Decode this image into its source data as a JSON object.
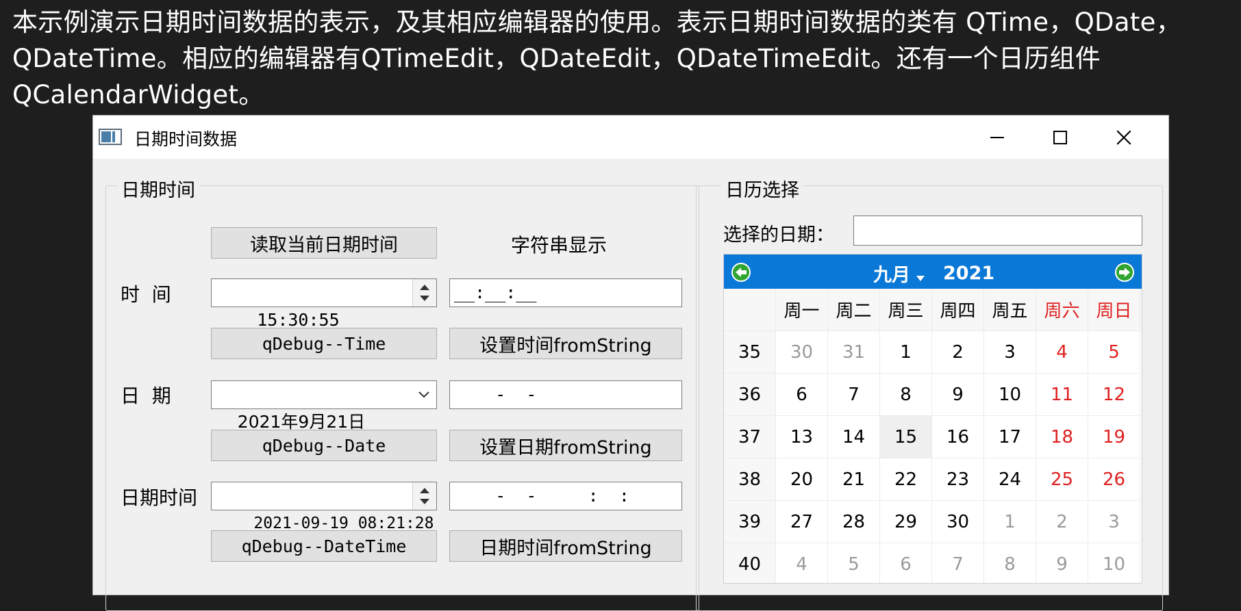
{
  "caption": "本示例演示日期时间数据的表示，及其相应编辑器的使用。表示日期时间数据的类有 QTime，QDate， QDateTime。相应的编辑器有QTimeEdit，QDateEdit，QDateTimeEdit。还有一个日历组件QCalendarWidget。",
  "window": {
    "title": "日期时间数据"
  },
  "left_group": {
    "title": "日期时间",
    "read_button": "读取当前日期时间",
    "string_display_label": "字符串显示",
    "time_label": "时  间",
    "time_value": "15:30:55",
    "time_string": "__:__:__",
    "debug_time_button": "qDebug--Time",
    "set_time_button": "设置时间fromString",
    "date_label": "日  期",
    "date_value": "2021年9月21日",
    "date_string": "    -  -",
    "debug_date_button": "qDebug--Date",
    "set_date_button": "设置日期fromString",
    "datetime_label": "日期时间",
    "datetime_value": "2021-09-19 08:21:28",
    "datetime_string": "    -  -     :  :",
    "debug_datetime_button": "qDebug--DateTime",
    "set_datetime_button": "日期时间fromString"
  },
  "right_group": {
    "title": "日历选择",
    "selected_date_label": "选择的日期：",
    "selected_date_value": ""
  },
  "calendar": {
    "month": "九月",
    "year": "2021",
    "weekdays": [
      "周一",
      "周二",
      "周三",
      "周四",
      "周五",
      "周六",
      "周日"
    ],
    "weeks": [
      {
        "num": "35",
        "days": [
          "30",
          "31",
          "1",
          "2",
          "3",
          "4",
          "5"
        ]
      },
      {
        "num": "36",
        "days": [
          "6",
          "7",
          "8",
          "9",
          "10",
          "11",
          "12"
        ]
      },
      {
        "num": "37",
        "days": [
          "13",
          "14",
          "15",
          "16",
          "17",
          "18",
          "19"
        ]
      },
      {
        "num": "38",
        "days": [
          "20",
          "21",
          "22",
          "23",
          "24",
          "25",
          "26"
        ]
      },
      {
        "num": "39",
        "days": [
          "27",
          "28",
          "29",
          "30",
          "1",
          "2",
          "3"
        ]
      },
      {
        "num": "40",
        "days": [
          "4",
          "5",
          "6",
          "7",
          "8",
          "9",
          "10"
        ]
      }
    ],
    "out_of_month": [
      [
        0,
        0
      ],
      [
        0,
        1
      ],
      [
        4,
        4
      ],
      [
        4,
        5
      ],
      [
        4,
        6
      ],
      [
        5,
        0
      ],
      [
        5,
        1
      ],
      [
        5,
        2
      ],
      [
        5,
        3
      ],
      [
        5,
        4
      ],
      [
        5,
        5
      ],
      [
        5,
        6
      ]
    ],
    "selected_cell": [
      2,
      2
    ],
    "weekend_color": "#e02020",
    "muted_color": "#9a9a9a",
    "nav_color": "#0a78d7"
  }
}
